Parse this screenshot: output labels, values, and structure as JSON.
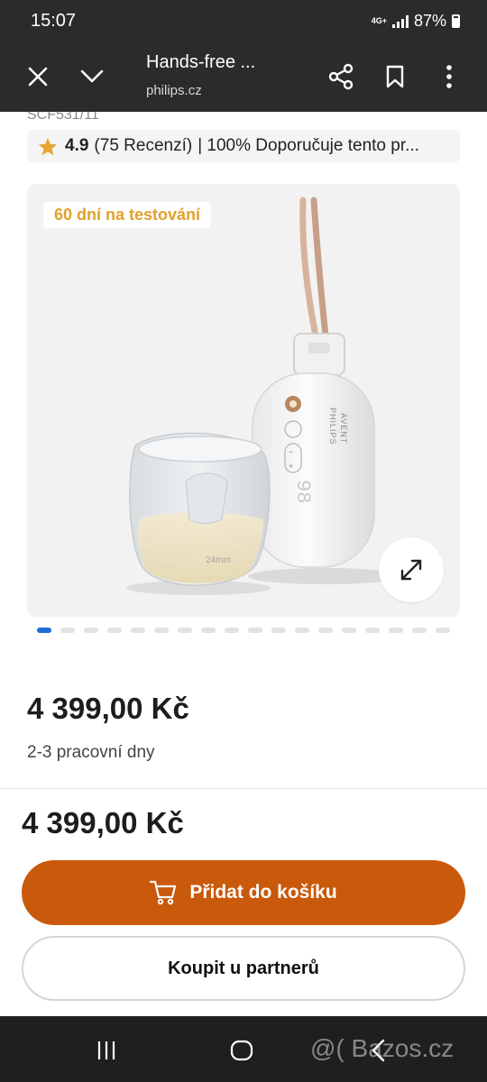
{
  "status_bar": {
    "time": "15:07",
    "network": "4G+",
    "battery": "87%"
  },
  "toolbar": {
    "title": "Hands-free ...",
    "url": "philips.cz"
  },
  "product": {
    "sku": "SCF531/11",
    "rating": "4.9",
    "review_count": "(75 Recenzí)",
    "rating_extra": "| 100% Doporučuje tento pr...",
    "badge": "60 dní na testování",
    "device_brand_line1": "PHILIPS",
    "device_brand_line2": "AVENT",
    "device_display": "98",
    "cup_marking": "24mm",
    "image_count": 18,
    "active_image_index": 0,
    "price": "4 399,00 Kč",
    "delivery": "2-3 pracovní dny"
  },
  "sticky": {
    "price": "4 399,00 Kč",
    "add_to_cart": "Přidat do košíku",
    "buy_partner": "Koupit u partnerů"
  },
  "watermark": "@( Bazos.cz",
  "colors": {
    "accent_orange": "#c9590b",
    "active_dot": "#1c6fd1",
    "badge_text": "#e0a12a",
    "star": "#e6a532"
  },
  "icons": [
    "close-icon",
    "chevron-down-icon",
    "share-icon",
    "bookmark-icon",
    "more-vert-icon",
    "star-icon",
    "expand-icon",
    "cart-icon",
    "recents-icon",
    "home-icon",
    "back-icon"
  ]
}
